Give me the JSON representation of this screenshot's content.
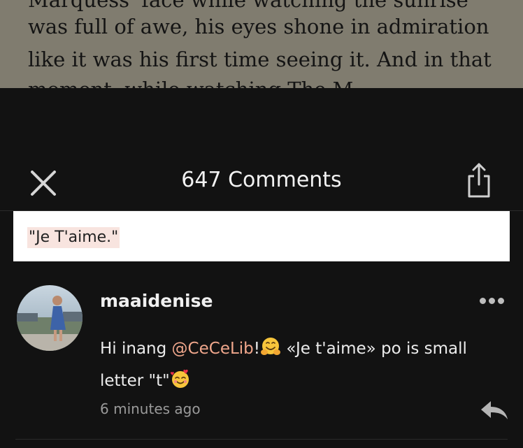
{
  "story": {
    "lines": [
      "Marquess' face while watching the sunrise",
      "was full of awe, his eyes shone in admiration",
      "like it was his first time seeing it. And in that",
      "moment, while watching The M"
    ]
  },
  "header": {
    "title": "647 Comments",
    "close_icon": "close-icon",
    "share_icon": "share-icon"
  },
  "quote": {
    "text": "\"Je T'aime.\""
  },
  "comment": {
    "username": "maaidenise",
    "text_before": "Hi inang ",
    "mention": "@CeCeLib",
    "text_middle": "!",
    "text_after": " «Je t'aime» po is small letter \"t\"",
    "timestamp": "6 minutes ago",
    "emoji_1": "hugging-face-emoji",
    "emoji_2": "smiling-face-with-hearts-emoji",
    "more_icon": "more-dots-icon",
    "reply_icon": "reply-arrow-icon"
  },
  "colors": {
    "background": "#121212",
    "story_background": "#807c6f",
    "mention": "#f0a78c",
    "quote_highlight": "#f8e4df"
  }
}
